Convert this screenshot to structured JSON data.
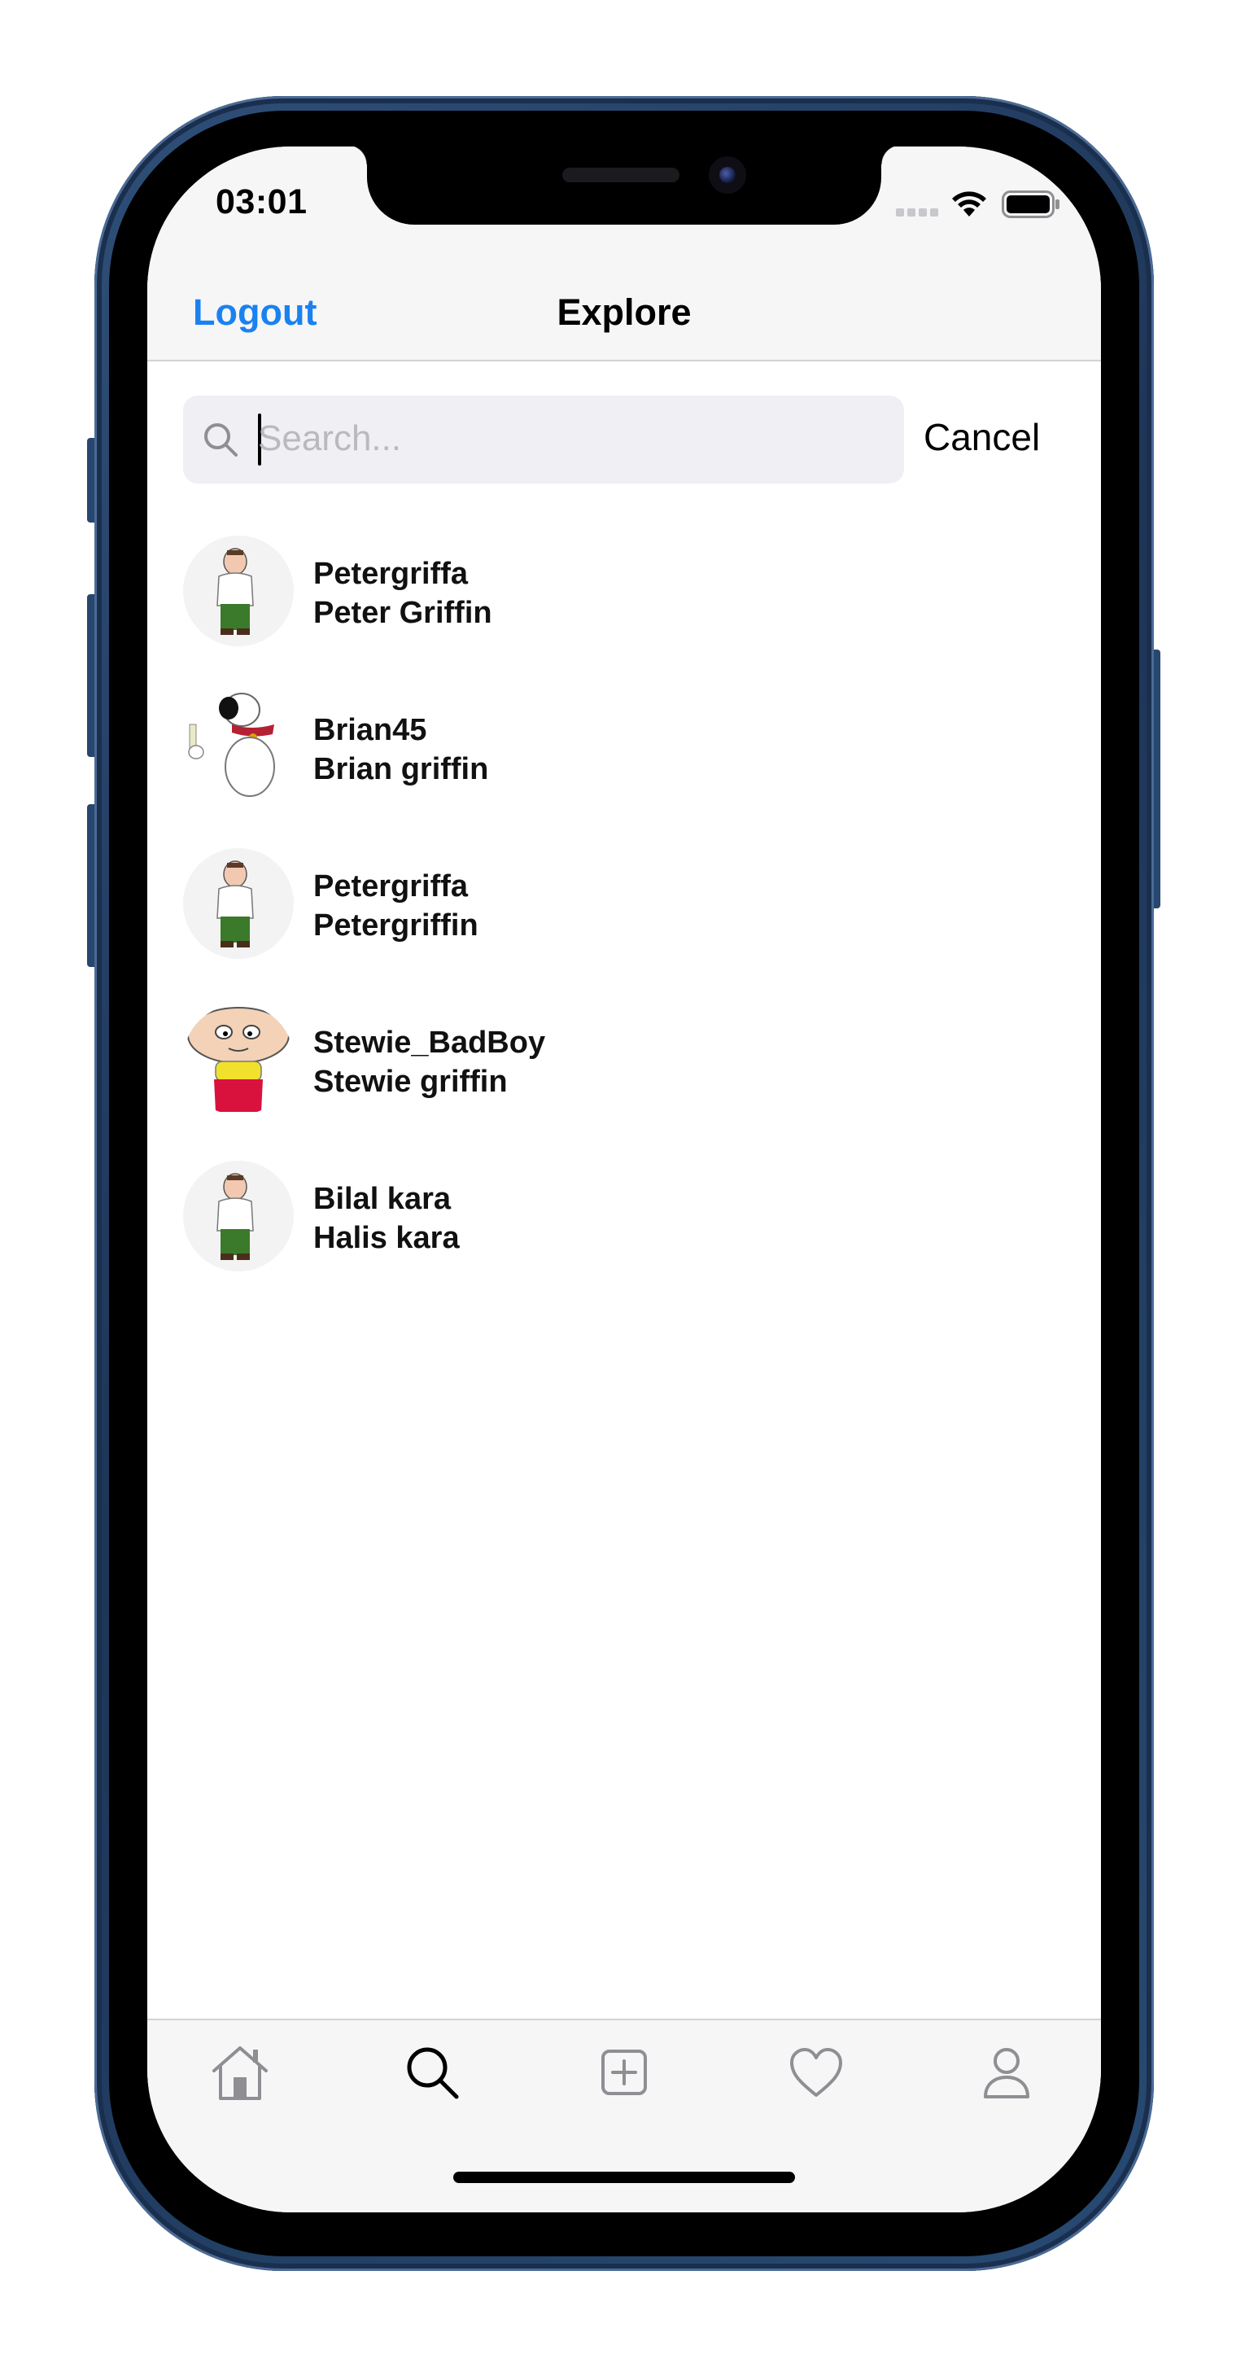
{
  "status_bar": {
    "time": "03:01",
    "icons": [
      "cellular-signal-icon",
      "wifi-icon",
      "battery-icon"
    ]
  },
  "nav_bar": {
    "title": "Explore",
    "logout_label": "Logout",
    "accent_color": "#1a82f0"
  },
  "search": {
    "placeholder": "Search...",
    "value": "",
    "cancel_label": "Cancel"
  },
  "users": [
    {
      "username": "Petergriffa",
      "full_name": "Peter Griffin",
      "avatar": "peter-avatar"
    },
    {
      "username": "Brian45",
      "full_name": "Brian griffin",
      "avatar": "brian-avatar"
    },
    {
      "username": "Petergriffa",
      "full_name": "Petergriffin",
      "avatar": "peter-avatar"
    },
    {
      "username": "Stewie_BadBoy",
      "full_name": "Stewie griffin",
      "avatar": "stewie-avatar"
    },
    {
      "username": "Bilal kara",
      "full_name": "Halis kara",
      "avatar": "peter-avatar"
    }
  ],
  "tab_bar": {
    "tabs": [
      {
        "icon": "home-icon",
        "selected": false
      },
      {
        "icon": "search-icon",
        "selected": true
      },
      {
        "icon": "add-post-icon",
        "selected": false
      },
      {
        "icon": "heart-icon",
        "selected": false
      },
      {
        "icon": "profile-icon",
        "selected": false
      }
    ]
  }
}
